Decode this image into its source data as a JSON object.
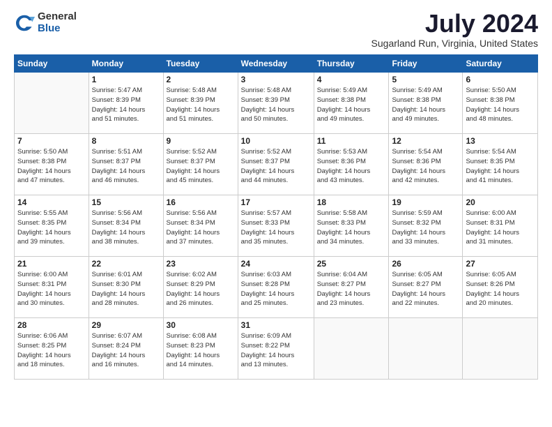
{
  "header": {
    "logo_general": "General",
    "logo_blue": "Blue",
    "title": "July 2024",
    "subtitle": "Sugarland Run, Virginia, United States"
  },
  "weekdays": [
    "Sunday",
    "Monday",
    "Tuesday",
    "Wednesday",
    "Thursday",
    "Friday",
    "Saturday"
  ],
  "weeks": [
    [
      {
        "day": "",
        "info": ""
      },
      {
        "day": "1",
        "info": "Sunrise: 5:47 AM\nSunset: 8:39 PM\nDaylight: 14 hours\nand 51 minutes."
      },
      {
        "day": "2",
        "info": "Sunrise: 5:48 AM\nSunset: 8:39 PM\nDaylight: 14 hours\nand 51 minutes."
      },
      {
        "day": "3",
        "info": "Sunrise: 5:48 AM\nSunset: 8:39 PM\nDaylight: 14 hours\nand 50 minutes."
      },
      {
        "day": "4",
        "info": "Sunrise: 5:49 AM\nSunset: 8:38 PM\nDaylight: 14 hours\nand 49 minutes."
      },
      {
        "day": "5",
        "info": "Sunrise: 5:49 AM\nSunset: 8:38 PM\nDaylight: 14 hours\nand 49 minutes."
      },
      {
        "day": "6",
        "info": "Sunrise: 5:50 AM\nSunset: 8:38 PM\nDaylight: 14 hours\nand 48 minutes."
      }
    ],
    [
      {
        "day": "7",
        "info": "Sunrise: 5:50 AM\nSunset: 8:38 PM\nDaylight: 14 hours\nand 47 minutes."
      },
      {
        "day": "8",
        "info": "Sunrise: 5:51 AM\nSunset: 8:37 PM\nDaylight: 14 hours\nand 46 minutes."
      },
      {
        "day": "9",
        "info": "Sunrise: 5:52 AM\nSunset: 8:37 PM\nDaylight: 14 hours\nand 45 minutes."
      },
      {
        "day": "10",
        "info": "Sunrise: 5:52 AM\nSunset: 8:37 PM\nDaylight: 14 hours\nand 44 minutes."
      },
      {
        "day": "11",
        "info": "Sunrise: 5:53 AM\nSunset: 8:36 PM\nDaylight: 14 hours\nand 43 minutes."
      },
      {
        "day": "12",
        "info": "Sunrise: 5:54 AM\nSunset: 8:36 PM\nDaylight: 14 hours\nand 42 minutes."
      },
      {
        "day": "13",
        "info": "Sunrise: 5:54 AM\nSunset: 8:35 PM\nDaylight: 14 hours\nand 41 minutes."
      }
    ],
    [
      {
        "day": "14",
        "info": "Sunrise: 5:55 AM\nSunset: 8:35 PM\nDaylight: 14 hours\nand 39 minutes."
      },
      {
        "day": "15",
        "info": "Sunrise: 5:56 AM\nSunset: 8:34 PM\nDaylight: 14 hours\nand 38 minutes."
      },
      {
        "day": "16",
        "info": "Sunrise: 5:56 AM\nSunset: 8:34 PM\nDaylight: 14 hours\nand 37 minutes."
      },
      {
        "day": "17",
        "info": "Sunrise: 5:57 AM\nSunset: 8:33 PM\nDaylight: 14 hours\nand 35 minutes."
      },
      {
        "day": "18",
        "info": "Sunrise: 5:58 AM\nSunset: 8:33 PM\nDaylight: 14 hours\nand 34 minutes."
      },
      {
        "day": "19",
        "info": "Sunrise: 5:59 AM\nSunset: 8:32 PM\nDaylight: 14 hours\nand 33 minutes."
      },
      {
        "day": "20",
        "info": "Sunrise: 6:00 AM\nSunset: 8:31 PM\nDaylight: 14 hours\nand 31 minutes."
      }
    ],
    [
      {
        "day": "21",
        "info": "Sunrise: 6:00 AM\nSunset: 8:31 PM\nDaylight: 14 hours\nand 30 minutes."
      },
      {
        "day": "22",
        "info": "Sunrise: 6:01 AM\nSunset: 8:30 PM\nDaylight: 14 hours\nand 28 minutes."
      },
      {
        "day": "23",
        "info": "Sunrise: 6:02 AM\nSunset: 8:29 PM\nDaylight: 14 hours\nand 26 minutes."
      },
      {
        "day": "24",
        "info": "Sunrise: 6:03 AM\nSunset: 8:28 PM\nDaylight: 14 hours\nand 25 minutes."
      },
      {
        "day": "25",
        "info": "Sunrise: 6:04 AM\nSunset: 8:27 PM\nDaylight: 14 hours\nand 23 minutes."
      },
      {
        "day": "26",
        "info": "Sunrise: 6:05 AM\nSunset: 8:27 PM\nDaylight: 14 hours\nand 22 minutes."
      },
      {
        "day": "27",
        "info": "Sunrise: 6:05 AM\nSunset: 8:26 PM\nDaylight: 14 hours\nand 20 minutes."
      }
    ],
    [
      {
        "day": "28",
        "info": "Sunrise: 6:06 AM\nSunset: 8:25 PM\nDaylight: 14 hours\nand 18 minutes."
      },
      {
        "day": "29",
        "info": "Sunrise: 6:07 AM\nSunset: 8:24 PM\nDaylight: 14 hours\nand 16 minutes."
      },
      {
        "day": "30",
        "info": "Sunrise: 6:08 AM\nSunset: 8:23 PM\nDaylight: 14 hours\nand 14 minutes."
      },
      {
        "day": "31",
        "info": "Sunrise: 6:09 AM\nSunset: 8:22 PM\nDaylight: 14 hours\nand 13 minutes."
      },
      {
        "day": "",
        "info": ""
      },
      {
        "day": "",
        "info": ""
      },
      {
        "day": "",
        "info": ""
      }
    ]
  ]
}
